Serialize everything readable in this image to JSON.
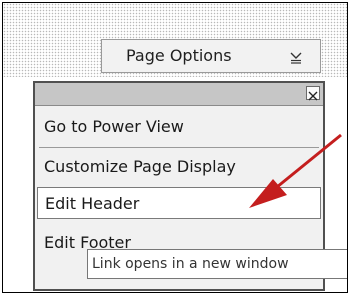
{
  "toolbar": {
    "page_options_label": "Page Options",
    "page_options_icon": "chevron-down-icon"
  },
  "menu": {
    "close_icon": "close-icon",
    "items": [
      {
        "label": "Go to Power View"
      },
      {
        "label": "Customize Page Display"
      },
      {
        "label": "Edit Header"
      },
      {
        "label": "Edit Footer"
      }
    ]
  },
  "tooltip": {
    "text": "Link opens in a new window"
  },
  "annotation": {
    "arrow_color": "#cc2020",
    "arrow_icon": "red-arrow-icon"
  }
}
